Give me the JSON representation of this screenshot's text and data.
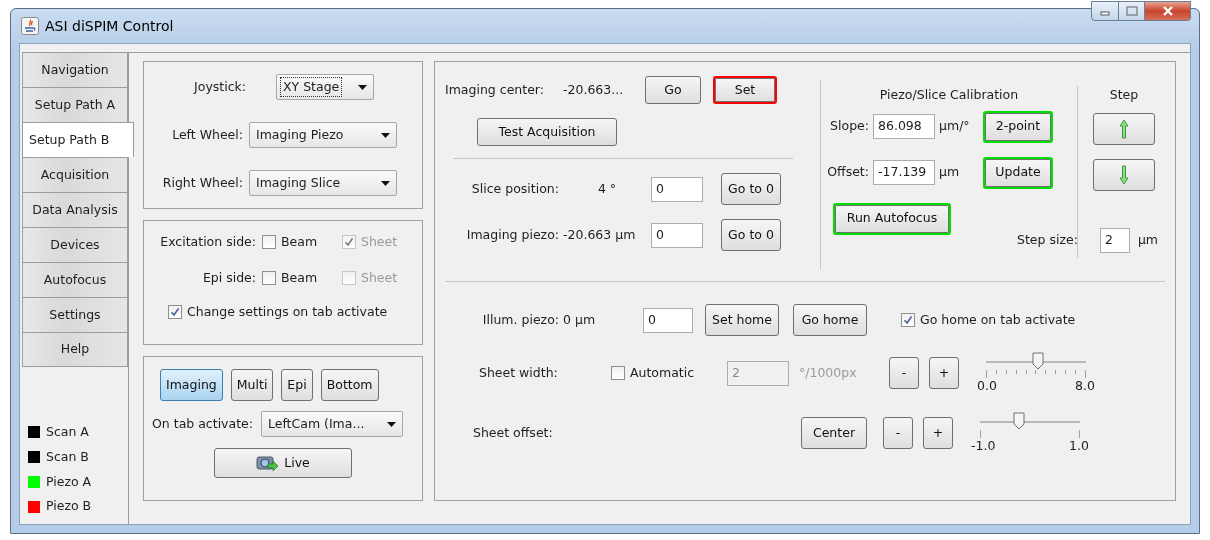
{
  "window": {
    "title": "ASI diSPIM Control"
  },
  "tabs": [
    {
      "label": "Navigation",
      "selected": false
    },
    {
      "label": "Setup Path A",
      "selected": false
    },
    {
      "label": "Setup Path B",
      "selected": true
    },
    {
      "label": "Acquisition",
      "selected": false
    },
    {
      "label": "Data Analysis",
      "selected": false
    },
    {
      "label": "Devices",
      "selected": false
    },
    {
      "label": "Autofocus",
      "selected": false
    },
    {
      "label": "Settings",
      "selected": false
    },
    {
      "label": "Help",
      "selected": false
    }
  ],
  "legend": [
    {
      "label": "Scan A",
      "color": "#000000"
    },
    {
      "label": "Scan B",
      "color": "#000000"
    },
    {
      "label": "Piezo A",
      "color": "#00ff00"
    },
    {
      "label": "Piezo B",
      "color": "#ff0000"
    }
  ],
  "joystick": [
    {
      "label": "Joystick:",
      "value": "XY Stage",
      "focused": true
    },
    {
      "label": "Left Wheel:",
      "value": "Imaging Piezo",
      "focused": false
    },
    {
      "label": "Right Wheel:",
      "value": "Imaging Slice",
      "focused": false
    }
  ],
  "sides": [
    {
      "label": "Excitation side:",
      "options": [
        {
          "label": "Beam",
          "checked": false,
          "disabled": false
        },
        {
          "label": "Sheet",
          "checked": true,
          "disabled": true
        }
      ]
    },
    {
      "label": "Epi side:",
      "options": [
        {
          "label": "Beam",
          "checked": false,
          "disabled": false
        },
        {
          "label": "Sheet",
          "checked": false,
          "disabled": true
        }
      ]
    }
  ],
  "change_settings": {
    "label": "Change settings on tab activate",
    "checked": true
  },
  "modes": [
    {
      "label": "Imaging",
      "selected": true
    },
    {
      "label": "Multi",
      "selected": false
    },
    {
      "label": "Epi",
      "selected": false
    },
    {
      "label": "Bottom",
      "selected": false
    }
  ],
  "on_tab_activate": {
    "label": "On tab activate:",
    "value": "LeftCam (Ima..."
  },
  "live_button": {
    "label": "Live"
  },
  "imaging_center": {
    "label": "Imaging center:",
    "reading": "-20.663...",
    "buttons": [
      {
        "label": "Go"
      },
      {
        "label": "Set",
        "color": "#ff0000"
      }
    ]
  },
  "test_acquisition": {
    "label": "Test Acquisition"
  },
  "positions": [
    {
      "label": "Slice position:",
      "reading": "4 °",
      "value": "0",
      "button": "Go to 0"
    },
    {
      "label": "Imaging piezo:",
      "reading": "-20.663 µm",
      "value": "0",
      "button": "Go to 0"
    }
  ],
  "calibration": {
    "title": "Piezo/Slice Calibration",
    "rows": [
      {
        "label": "Slope:",
        "value": "86.098",
        "unit": "µm/°",
        "button": "2-point",
        "color": "#00e000"
      },
      {
        "label": "Offset:",
        "value": "-17.139",
        "unit": "µm",
        "button": "Update",
        "color": "#00e000"
      }
    ],
    "autofocus": {
      "label": "Run Autofocus",
      "color": "#00e000"
    }
  },
  "step": {
    "title": "Step",
    "size_label": "Step size:",
    "value": "2",
    "unit": "µm"
  },
  "illum": {
    "label": "Illum. piezo:",
    "reading": "0 µm",
    "value": "0",
    "buttons": [
      "Set home",
      "Go home"
    ],
    "checkbox": {
      "label": "Go home on tab activate",
      "checked": true
    }
  },
  "sheet_width": {
    "label": "Sheet width:",
    "auto": {
      "label": "Automatic",
      "checked": false
    },
    "value": "2",
    "disabled": true,
    "unit": "°/1000px",
    "buttons": [
      "-",
      "+"
    ],
    "slider": {
      "level": 0.52,
      "min_label": "0.0",
      "max_label": "8.0",
      "ticks": true
    }
  },
  "sheet_offset": {
    "label": "Sheet offset:",
    "button": "Center",
    "buttons": [
      "-",
      "+"
    ],
    "slider": {
      "level": 0.4,
      "min_label": "-1.0",
      "max_label": "1.0",
      "ticks": false
    }
  }
}
